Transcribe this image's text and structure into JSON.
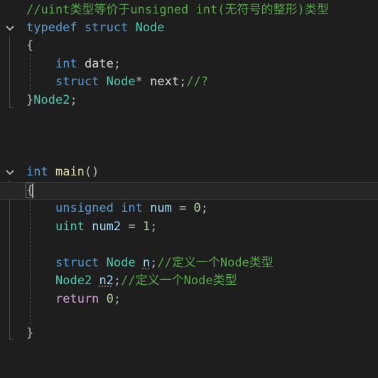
{
  "code_editor": {
    "lines": [
      {
        "comment": "//uint类型等价于unsigned int(无符号的整形)类型"
      },
      {
        "typedef": "typedef",
        "struct": "struct",
        "name": "Node"
      },
      {
        "brace_open": "{"
      },
      {
        "type": "int",
        "field": "date",
        "semi": ";"
      },
      {
        "struct": "struct",
        "name": "Node",
        "star": "*",
        "field": "next",
        "semi": ";",
        "comment": "//?"
      },
      {
        "brace_close": "}",
        "alias": "Node2",
        "semi": ";"
      },
      {
        "ret_type": "int",
        "fn_name": "main",
        "parens": "()"
      },
      {
        "brace_open": "{"
      },
      {
        "kw1": "unsigned",
        "kw2": "int",
        "var": "num",
        "op": " = ",
        "val": "0",
        "semi": ";"
      },
      {
        "type": "uint",
        "var": "num2",
        "op": " = ",
        "val": "1",
        "semi": ";"
      },
      {
        "struct": "struct",
        "name": "Node",
        "var": "n",
        "semi": ";",
        "comment": "//定义一个Node类型"
      },
      {
        "alias": "Node2",
        "var": "n2",
        "semi": ";",
        "comment": "//定义一个Node类型"
      },
      {
        "kw": "return",
        "val": "0",
        "semi": ";"
      },
      {
        "brace_close": "}"
      }
    ]
  }
}
